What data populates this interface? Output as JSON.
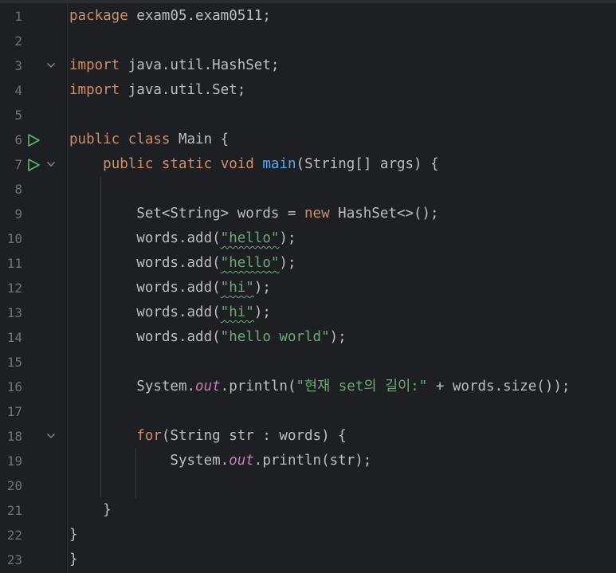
{
  "editor": {
    "lines": [
      {
        "num": "1",
        "icons": [],
        "tokens": [
          {
            "t": "package",
            "c": "kw"
          },
          {
            "t": " exam05.exam0511;"
          }
        ]
      },
      {
        "num": "2",
        "icons": [],
        "tokens": []
      },
      {
        "num": "3",
        "icons": [
          "fold"
        ],
        "tokens": [
          {
            "t": "import",
            "c": "kw"
          },
          {
            "t": " java.util.HashSet;"
          }
        ]
      },
      {
        "num": "4",
        "icons": [],
        "tokens": [
          {
            "t": "import",
            "c": "kw"
          },
          {
            "t": " java.util.Set;"
          }
        ]
      },
      {
        "num": "5",
        "icons": [],
        "tokens": []
      },
      {
        "num": "6",
        "icons": [
          "run"
        ],
        "tokens": [
          {
            "t": "public",
            "c": "kw"
          },
          {
            "t": " "
          },
          {
            "t": "class",
            "c": "kw"
          },
          {
            "t": " Main {"
          }
        ]
      },
      {
        "num": "7",
        "icons": [
          "run",
          "fold"
        ],
        "tokens": [
          {
            "t": "    "
          },
          {
            "t": "public",
            "c": "kw"
          },
          {
            "t": " "
          },
          {
            "t": "static",
            "c": "kw"
          },
          {
            "t": " "
          },
          {
            "t": "void",
            "c": "kw"
          },
          {
            "t": " "
          },
          {
            "t": "main",
            "c": "fn"
          },
          {
            "t": "(String[] args) {"
          }
        ]
      },
      {
        "num": "8",
        "icons": [],
        "tokens": []
      },
      {
        "num": "9",
        "icons": [],
        "tokens": [
          {
            "t": "        Set<String> words = "
          },
          {
            "t": "new",
            "c": "kw"
          },
          {
            "t": " HashSet<>();"
          }
        ]
      },
      {
        "num": "10",
        "icons": [],
        "tokens": [
          {
            "t": "        words.add("
          },
          {
            "t": "\"hello\"",
            "c": "str wavy"
          },
          {
            "t": ");"
          }
        ]
      },
      {
        "num": "11",
        "icons": [],
        "tokens": [
          {
            "t": "        words.add("
          },
          {
            "t": "\"hello\"",
            "c": "str wavy"
          },
          {
            "t": ");"
          }
        ]
      },
      {
        "num": "12",
        "icons": [],
        "tokens": [
          {
            "t": "        words.add("
          },
          {
            "t": "\"hi\"",
            "c": "str wavy"
          },
          {
            "t": ");"
          }
        ]
      },
      {
        "num": "13",
        "icons": [],
        "tokens": [
          {
            "t": "        words.add("
          },
          {
            "t": "\"hi\"",
            "c": "str wavy"
          },
          {
            "t": ");"
          }
        ]
      },
      {
        "num": "14",
        "icons": [],
        "tokens": [
          {
            "t": "        words.add("
          },
          {
            "t": "\"hello world\"",
            "c": "str"
          },
          {
            "t": ");"
          }
        ]
      },
      {
        "num": "15",
        "icons": [],
        "tokens": []
      },
      {
        "num": "16",
        "icons": [],
        "tokens": [
          {
            "t": "        System."
          },
          {
            "t": "out",
            "c": "fld"
          },
          {
            "t": ".println("
          },
          {
            "t": "\"현재 set의 길이:\"",
            "c": "str"
          },
          {
            "t": " + words.size());"
          }
        ]
      },
      {
        "num": "17",
        "icons": [],
        "tokens": []
      },
      {
        "num": "18",
        "icons": [
          "fold"
        ],
        "tokens": [
          {
            "t": "        "
          },
          {
            "t": "for",
            "c": "kw"
          },
          {
            "t": "(String str : words) {"
          }
        ]
      },
      {
        "num": "19",
        "icons": [],
        "tokens": [
          {
            "t": "            System."
          },
          {
            "t": "out",
            "c": "fld"
          },
          {
            "t": ".println(str);"
          }
        ]
      },
      {
        "num": "20",
        "icons": [],
        "tokens": []
      },
      {
        "num": "21",
        "icons": [],
        "tokens": [
          {
            "t": "    }"
          }
        ]
      },
      {
        "num": "22",
        "icons": [],
        "tokens": [
          {
            "t": "}"
          }
        ]
      },
      {
        "num": "23",
        "icons": [],
        "tokens": [
          {
            "t": "}"
          }
        ]
      }
    ]
  },
  "colors": {
    "background": "#1e1f22",
    "keyword": "#cf8e6d",
    "string": "#6aab73",
    "method": "#56a8f5",
    "static_field": "#c77dbb",
    "text": "#bcbec4",
    "line_number": "#6f737a",
    "run_icon": "#5fb865"
  }
}
